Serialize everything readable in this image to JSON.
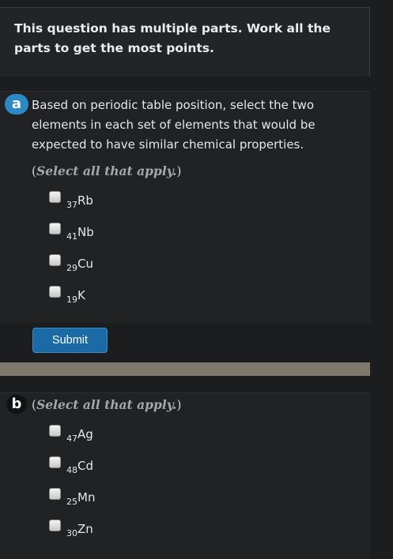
{
  "header": {
    "text": "This question has multiple parts. Work all the parts to get the most points."
  },
  "part_a": {
    "badge": "a",
    "question": "Based on periodic table position, select the two elements in each set of elements that would be expected to have similar chemical properties.",
    "instruction_open": "(",
    "instruction_italic": "Select all that apply.",
    "instruction_close": ")",
    "options": [
      {
        "sub": "37",
        "symbol": "Rb"
      },
      {
        "sub": "41",
        "symbol": "Nb"
      },
      {
        "sub": "29",
        "symbol": "Cu"
      },
      {
        "sub": "19",
        "symbol": "K"
      }
    ],
    "submit_label": "Submit"
  },
  "part_b": {
    "badge": "b",
    "instruction_open": "(",
    "instruction_italic": "Select all that apply.",
    "instruction_close": ")",
    "options": [
      {
        "sub": "47",
        "symbol": "Ag"
      },
      {
        "sub": "48",
        "symbol": "Cd"
      },
      {
        "sub": "25",
        "symbol": "Mn"
      },
      {
        "sub": "30",
        "symbol": "Zn"
      }
    ]
  }
}
